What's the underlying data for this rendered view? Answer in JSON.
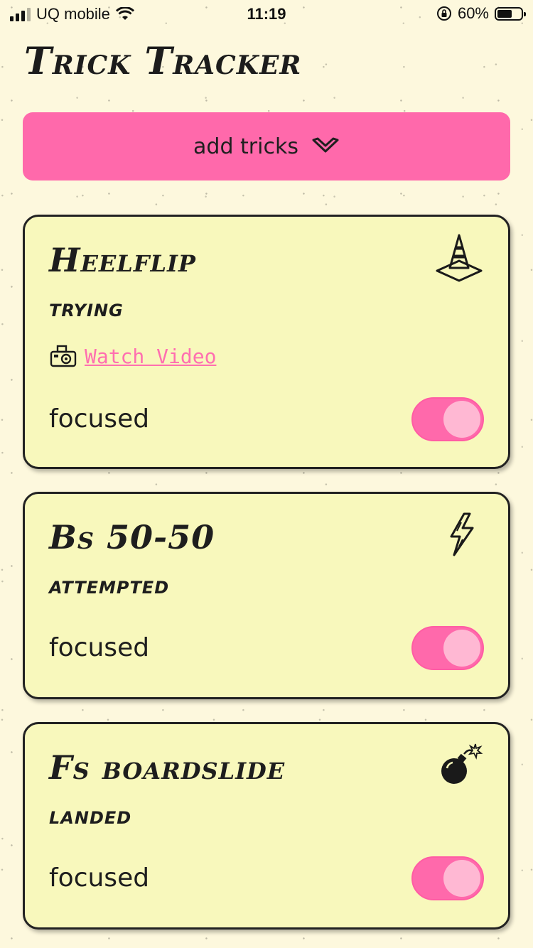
{
  "status_bar": {
    "carrier": "UQ mobile",
    "time": "11:19",
    "battery_percent": "60%"
  },
  "app": {
    "title": "Trick Tracker",
    "add_button_label": "add tricks",
    "accent_color": "#ff69ab",
    "card_color": "#f8f8bc"
  },
  "tricks": [
    {
      "name": "Heelflip",
      "status": "trying",
      "icon": "traffic-cone-icon",
      "video_link": "Watch Video",
      "focus_label": "focused",
      "focused": true
    },
    {
      "name": "Bs 50-50",
      "status": "attempted",
      "icon": "lightning-bolt-icon",
      "focus_label": "focused",
      "focused": true
    },
    {
      "name": "Fs boardslide",
      "status": "landed",
      "icon": "bomb-icon",
      "focus_label": "focused",
      "focused": true
    }
  ]
}
